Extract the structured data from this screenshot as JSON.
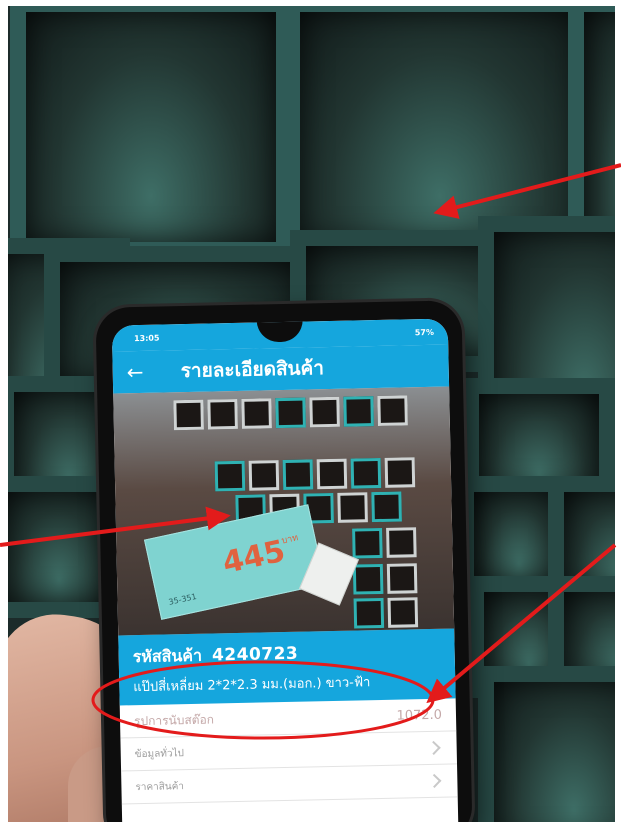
{
  "phone": {
    "status_time": "13:05",
    "status_indicators": "57%",
    "app_title": "รายละเอียดสินค้า",
    "back_icon": "arrow-left-icon",
    "product_image": {
      "tag_price": "445",
      "tag_unit": "บาท",
      "tag_code": "35-351"
    },
    "product": {
      "code_label": "รหัสสินค้า",
      "code_value": "4240723",
      "name": "แป๊ปสี่เหลี่ยม 2*2*2.3 มม.(มอก.) ขาว-ฟ้า"
    },
    "rows": [
      {
        "label": "รูปการนับสต๊อก",
        "value": "1072.0"
      },
      {
        "label": "ข้อมูลทั่วไป",
        "value": ""
      },
      {
        "label": "ราคาสินค้า",
        "value": ""
      }
    ]
  },
  "annotations": {
    "arrow_color": "#e31b1b",
    "ellipse_color": "#e31b1b"
  }
}
